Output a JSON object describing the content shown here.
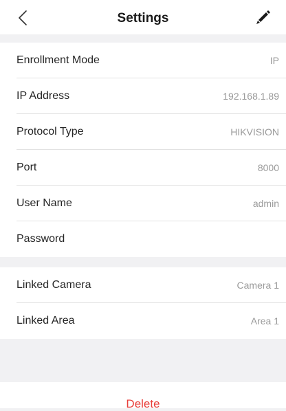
{
  "header": {
    "title": "Settings"
  },
  "icons": {
    "back": "chevron-left-icon",
    "edit": "pencil-icon"
  },
  "colors": {
    "background": "#f1f1f3",
    "delete": "#e8403c",
    "value_text": "#9a9a9a"
  },
  "device": {
    "rows": [
      {
        "label": "Enrollment Mode",
        "value": "IP"
      },
      {
        "label": "IP Address",
        "value": "192.168.1.89"
      },
      {
        "label": "Protocol Type",
        "value": "HIKVISION"
      },
      {
        "label": "Port",
        "value": "8000"
      },
      {
        "label": "User Name",
        "value": "admin"
      },
      {
        "label": "Password",
        "value": ""
      }
    ]
  },
  "linked": {
    "rows": [
      {
        "label": "Linked Camera",
        "value": "Camera 1"
      },
      {
        "label": "Linked Area",
        "value": "Area 1"
      }
    ]
  },
  "actions": {
    "delete_label": "Delete"
  }
}
